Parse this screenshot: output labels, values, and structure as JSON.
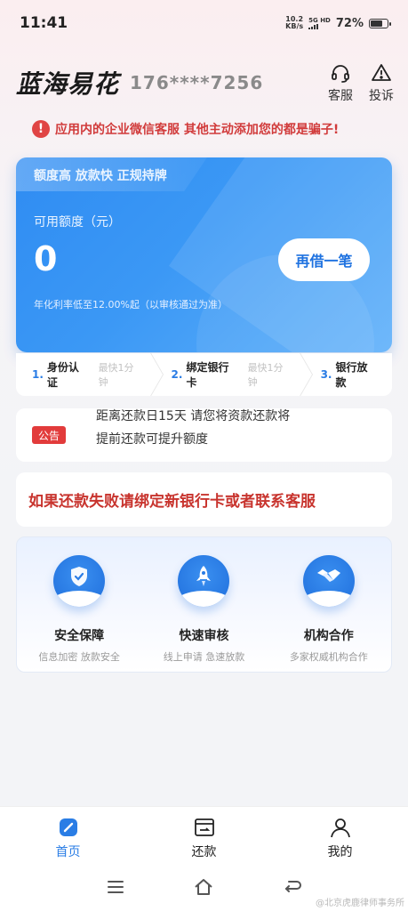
{
  "status": {
    "time": "11:41",
    "net_speed": "10.2",
    "net_unit": "KB/s",
    "signal_label": "5G HD",
    "battery": "72%",
    "battery_level": 0.72
  },
  "header": {
    "brand": "蓝海易花",
    "phone": "176****7256",
    "service_label": "客服",
    "complaint_label": "投诉"
  },
  "warning": {
    "text": "应用内的企业微信客服 其他主动添加您的都是骗子!"
  },
  "loan_card": {
    "tagline": "额度高 放款快 正规持牌",
    "available_label": "可用额度（元）",
    "amount": "0",
    "borrow_button": "再借一笔",
    "rate_note": "年化利率低至12.00%起（以审核通过为准）"
  },
  "steps": [
    {
      "num": "1.",
      "name": "身份认证",
      "time": "最快1分钟"
    },
    {
      "num": "2.",
      "name": "绑定银行卡",
      "time": "最快1分钟"
    },
    {
      "num": "3.",
      "name": "银行放款",
      "time": ""
    }
  ],
  "notice": {
    "badge": "公告",
    "line1": "距离还款日15天 请您将资款还款将",
    "line2": "提前还款可提升额度"
  },
  "alert": {
    "text": "如果还款失败请绑定新银行卡或者联系客服"
  },
  "features": [
    {
      "icon": "shield-check-icon",
      "title": "安全保障",
      "subtitle": "信息加密 放款安全"
    },
    {
      "icon": "rocket-icon",
      "title": "快速审核",
      "subtitle": "线上申请 急速放款"
    },
    {
      "icon": "handshake-icon",
      "title": "机构合作",
      "subtitle": "多家权威机构合作"
    }
  ],
  "tabbar": [
    {
      "icon": "home-icon",
      "label": "首页",
      "active": true
    },
    {
      "icon": "repay-icon",
      "label": "还款",
      "active": false
    },
    {
      "icon": "profile-icon",
      "label": "我的",
      "active": false
    }
  ],
  "watermark": "@北京虎鹿律师事务所",
  "colors": {
    "accent": "#2a7de5",
    "warning": "#d13b3b",
    "badge": "#e23b3b"
  }
}
